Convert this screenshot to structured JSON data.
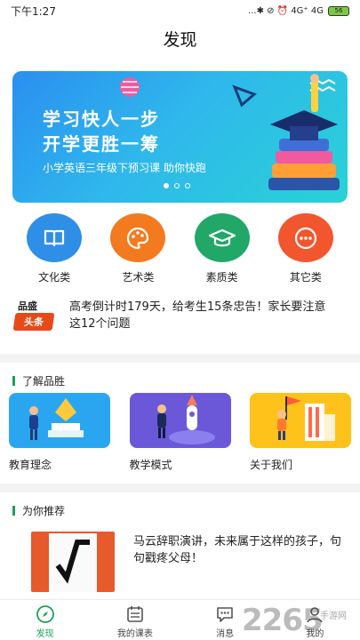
{
  "status_bar": {
    "time": "下午1:27",
    "network": "...✱ ⊘ ⏰ 4G⁺ 4G",
    "battery": "56"
  },
  "page_title": "发现",
  "banner": {
    "title_line1": "学习快人一步",
    "title_line2": "开学更胜一筹",
    "subtitle": "小学英语三年级下预习课  助你快跑"
  },
  "categories": [
    {
      "label": "文化类",
      "icon": "book-icon",
      "color": "#2f8fe6"
    },
    {
      "label": "艺术类",
      "icon": "palette-icon",
      "color": "#f47a1f"
    },
    {
      "label": "素质类",
      "icon": "graduation-cap-icon",
      "color": "#21a868"
    },
    {
      "label": "其它类",
      "icon": "more-icon",
      "color": "#f2562f"
    }
  ],
  "news": {
    "logo_top": "品盛",
    "logo_bottom": "头条",
    "text": "高考倒计时179天，给考生15条忠告！家长要注意这12个问题"
  },
  "about_section": {
    "title": "了解品胜",
    "items": [
      {
        "label": "教育理念"
      },
      {
        "label": "教学模式"
      },
      {
        "label": "关于我们"
      }
    ]
  },
  "recommend_section": {
    "title": "为你推荐",
    "article_text": "马云辞职演讲，未来属于这样的孩子，句句戳疼父母！"
  },
  "tabs": [
    {
      "label": "发现",
      "icon": "compass-icon",
      "active": true
    },
    {
      "label": "我的课表",
      "icon": "calendar-icon",
      "active": false
    },
    {
      "label": "消息",
      "icon": "message-icon",
      "active": false
    },
    {
      "label": "我的",
      "icon": "user-icon",
      "active": false
    }
  ],
  "watermark": {
    "main": "2265",
    "sub": "手游网"
  },
  "colors": {
    "accent": "#1e9e5a",
    "banner_start": "#2a8ff0",
    "banner_end": "#29d2d6"
  }
}
